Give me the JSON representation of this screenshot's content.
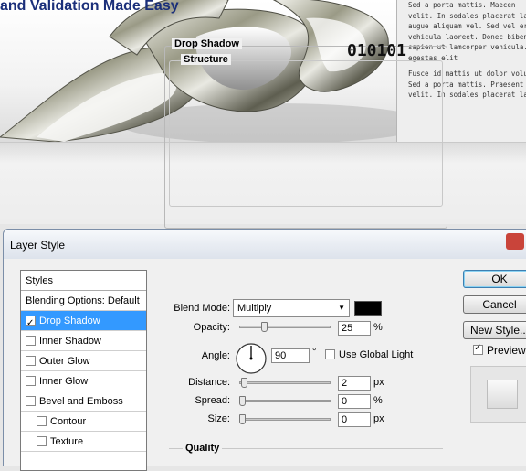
{
  "webpage": {
    "headline": "and Validation Made Easy",
    "paragraphs": [
      "Sed a porta mattis. Maecen\nvelit. In sodales placerat lacus, e\naugue aliquam vel. Sed vel eros\nvehicula laoreet. Donec bibendu\nsapien ut lamcorper vehicula. Nu\negestas elit",
      "Fusce id mattis ut dolor volutp\nSed a porta mattis. Praesent v\nvelit. In sodales placerat lacus"
    ]
  },
  "dialog": {
    "title": "Layer Style",
    "styles_header": "Styles",
    "styles": [
      {
        "label": "Blending Options: Default",
        "checkbox": false,
        "checked": false,
        "selected": false,
        "sub": false
      },
      {
        "label": "Drop Shadow",
        "checkbox": true,
        "checked": true,
        "selected": true,
        "sub": false
      },
      {
        "label": "Inner Shadow",
        "checkbox": true,
        "checked": false,
        "selected": false,
        "sub": false
      },
      {
        "label": "Outer Glow",
        "checkbox": true,
        "checked": false,
        "selected": false,
        "sub": false
      },
      {
        "label": "Inner Glow",
        "checkbox": true,
        "checked": false,
        "selected": false,
        "sub": false
      },
      {
        "label": "Bevel and Emboss",
        "checkbox": true,
        "checked": false,
        "selected": false,
        "sub": false
      },
      {
        "label": "Contour",
        "checkbox": true,
        "checked": false,
        "selected": false,
        "sub": true
      },
      {
        "label": "Texture",
        "checkbox": true,
        "checked": false,
        "selected": false,
        "sub": true
      }
    ],
    "group_title": "Drop Shadow",
    "structure_title": "Structure",
    "overlay_text": "010101",
    "blend_mode_label": "Blend Mode:",
    "blend_mode_value": "Multiply",
    "shadow_color": "#000000",
    "opacity_label": "Opacity:",
    "opacity_value": "25",
    "opacity_unit": "%",
    "angle_label": "Angle:",
    "angle_value": "90",
    "angle_unit": "°",
    "use_global_light_label": "Use Global Light",
    "use_global_light_checked": false,
    "distance_label": "Distance:",
    "distance_value": "2",
    "distance_unit": "px",
    "spread_label": "Spread:",
    "spread_value": "0",
    "spread_unit": "%",
    "size_label": "Size:",
    "size_value": "0",
    "size_unit": "px",
    "quality_title": "Quality",
    "ok_label": "OK",
    "cancel_label": "Cancel",
    "new_style_label": "New Style...",
    "preview_label": "Preview",
    "preview_checked": true
  }
}
